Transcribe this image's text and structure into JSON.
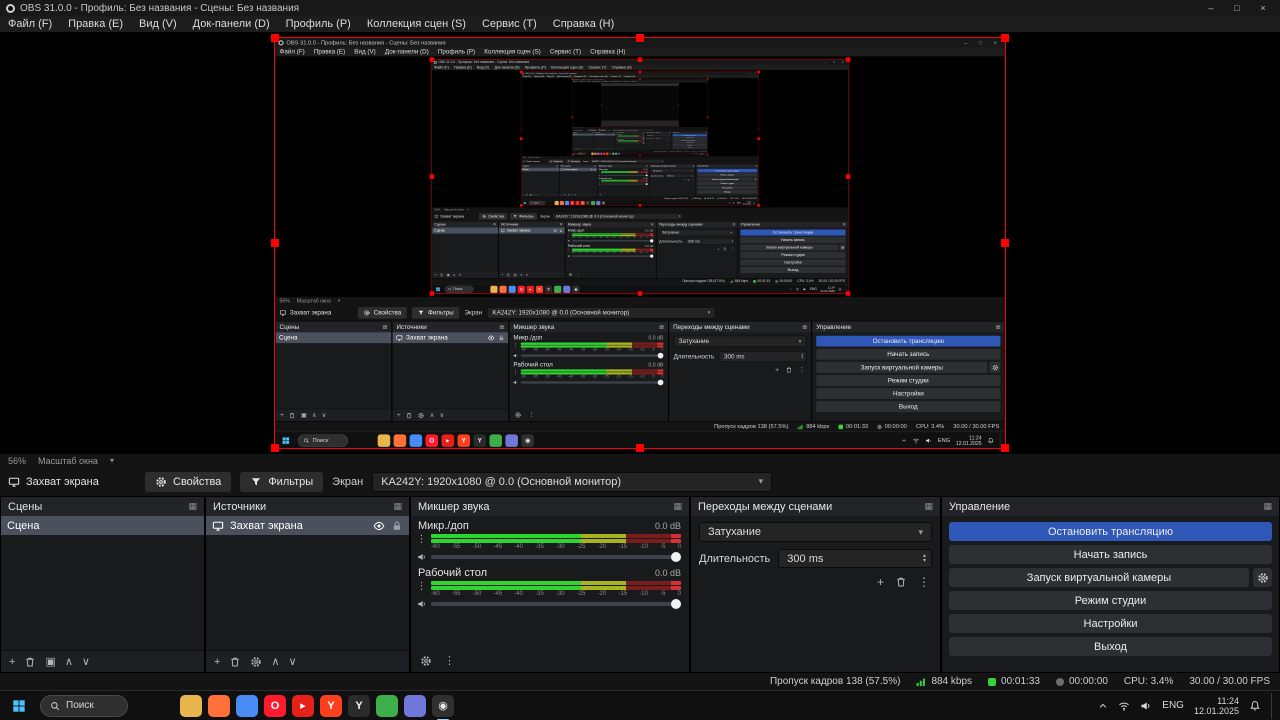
{
  "window": {
    "title": "OBS 31.0.0 - Профиль: Без названия - Сцены: Без названия",
    "minimize": "–",
    "maximize": "□",
    "close": "×"
  },
  "menu": {
    "items": [
      "Файл (F)",
      "Правка (E)",
      "Вид (V)",
      "Док-панели (D)",
      "Профиль (P)",
      "Коллекция сцен (S)",
      "Сервис (T)",
      "Справка (H)"
    ]
  },
  "preview": {
    "zoom_value": "56%",
    "zoom_label": "Масштаб окна"
  },
  "source_toolbar": {
    "source_name": "Захват экрана",
    "properties": "Свойства",
    "filters": "Фильтры",
    "screen_label": "Экран",
    "screen_value": "KA242Y: 1920x1080 @ 0.0 (Основной монитор)"
  },
  "docks": {
    "scenes": {
      "title": "Сцены",
      "items": [
        "Сцена"
      ]
    },
    "sources": {
      "title": "Источники",
      "items": [
        "Захват экрана"
      ]
    },
    "mixer": {
      "title": "Микшер звука",
      "channels": [
        {
          "name": "Микр./доп",
          "db": "0.0 dB"
        },
        {
          "name": "Рабочий стол",
          "db": "0.0 dB"
        }
      ],
      "ticks": [
        "-60",
        "-55",
        "-50",
        "-45",
        "-40",
        "-35",
        "-30",
        "-25",
        "-20",
        "-15",
        "-10",
        "-5",
        "0"
      ]
    },
    "transitions": {
      "title": "Переходы между сценами",
      "transition": "Затухание",
      "duration_label": "Длительность",
      "duration_value": "300 ms"
    },
    "controls": {
      "title": "Управление",
      "buttons": [
        "Остановить трансляцию",
        "Начать запись",
        "Запуск виртуальной камеры",
        "Режим студии",
        "Настройки",
        "Выход"
      ]
    }
  },
  "statusbar": {
    "dropped_frames": "Пропуск кадров 138 (57.5%)",
    "bitrate": "884 kbps",
    "stream_time": "00:01:33",
    "rec_time": "00:00:00",
    "cpu": "CPU: 3.4%",
    "fps": "30.00 / 30.00 FPS"
  },
  "taskbar": {
    "search_placeholder": "Поиск",
    "apps": [
      {
        "name": "explorer",
        "color": "#e8b64c"
      },
      {
        "name": "firefox",
        "color": "#ff7139"
      },
      {
        "name": "chrome",
        "color": "#4a8cf5"
      },
      {
        "name": "opera",
        "color": "#ff1b2d",
        "label": "O"
      },
      {
        "name": "youtube",
        "color": "#e62117",
        "label": "▸"
      },
      {
        "name": "yandex-browser",
        "color": "#fc3f1d",
        "label": "Y"
      },
      {
        "name": "music",
        "color": "#2b2b2b",
        "label": "Y",
        "fg": "#f5f5f5"
      },
      {
        "name": "green-app",
        "color": "#3dae4a"
      },
      {
        "name": "discord",
        "color": "#6f77d9"
      },
      {
        "name": "obs-studio",
        "color": "#303030",
        "label": "◉",
        "fg": "#e8e8e8",
        "active": true
      }
    ],
    "tray": {
      "lang": "ENG",
      "time": "11:24",
      "date": "12.01.2025"
    }
  },
  "icons": {
    "caret_down": "▾",
    "spinner_up": "▴",
    "spinner_down": "▾",
    "dots_menu": "⋮",
    "add": "+",
    "move_up": "∧",
    "move_down": "∨",
    "dock_menu": "▦",
    "scene_filters": "▣"
  },
  "colors": {
    "accent_blue": "#2e57b8",
    "selection_gray": "#4a515c",
    "capture_border": "#ff0000",
    "meter_green": "#2fd42f",
    "meter_yellow": "#a8b320",
    "meter_red": "#7a1d1d",
    "live_green": "#3ad23a"
  }
}
